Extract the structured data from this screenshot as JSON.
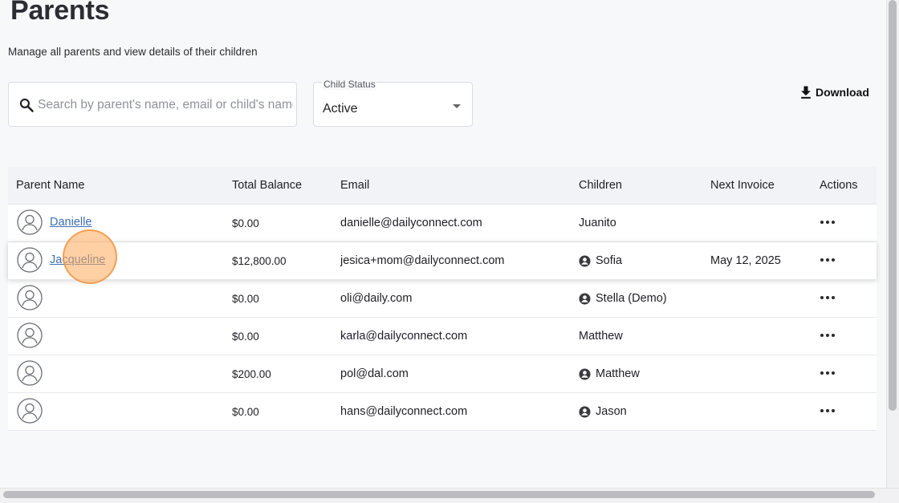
{
  "page": {
    "title": "Parents",
    "subtitle": "Manage all parents and view details of their children"
  },
  "search": {
    "placeholder": "Search by parent's name, email or child's name",
    "value": ""
  },
  "child_status": {
    "label": "Child Status",
    "value": "Active"
  },
  "toolbar": {
    "download_label": "Download"
  },
  "table": {
    "columns": {
      "parent_name": "Parent Name",
      "total_balance": "Total Balance",
      "email": "Email",
      "children": "Children",
      "next_invoice": "Next Invoice",
      "actions": "Actions"
    },
    "rows": [
      {
        "name": "Danielle",
        "balance": "$0.00",
        "email": "danielle@dailyconnect.com",
        "child": "Juanito",
        "child_icon": false,
        "next_invoice": ""
      },
      {
        "name": "Jacqueline",
        "balance": "$12,800.00",
        "email": "jesica+mom@dailyconnect.com",
        "child": "Sofia",
        "child_icon": true,
        "next_invoice": "May 12, 2025"
      },
      {
        "name": "",
        "balance": "$0.00",
        "email": "oli@daily.com",
        "child": "Stella (Demo)",
        "child_icon": true,
        "next_invoice": ""
      },
      {
        "name": "",
        "balance": "$0.00",
        "email": "karla@dailyconnect.com",
        "child": "Matthew",
        "child_icon": false,
        "next_invoice": ""
      },
      {
        "name": "",
        "balance": "$200.00",
        "email": "pol@dal.com",
        "child": "Matthew",
        "child_icon": true,
        "next_invoice": ""
      },
      {
        "name": "",
        "balance": "$0.00",
        "email": "hans@dailyconnect.com",
        "child": "Jason",
        "child_icon": true,
        "next_invoice": ""
      }
    ]
  },
  "colors": {
    "link": "#3d6fb6",
    "highlight": "#ffaa5a"
  },
  "icons": {
    "search": "search-icon",
    "download": "download-icon",
    "avatar": "user-avatar-icon",
    "child": "person-circle-icon",
    "actions": "more-horizontal-icon"
  }
}
